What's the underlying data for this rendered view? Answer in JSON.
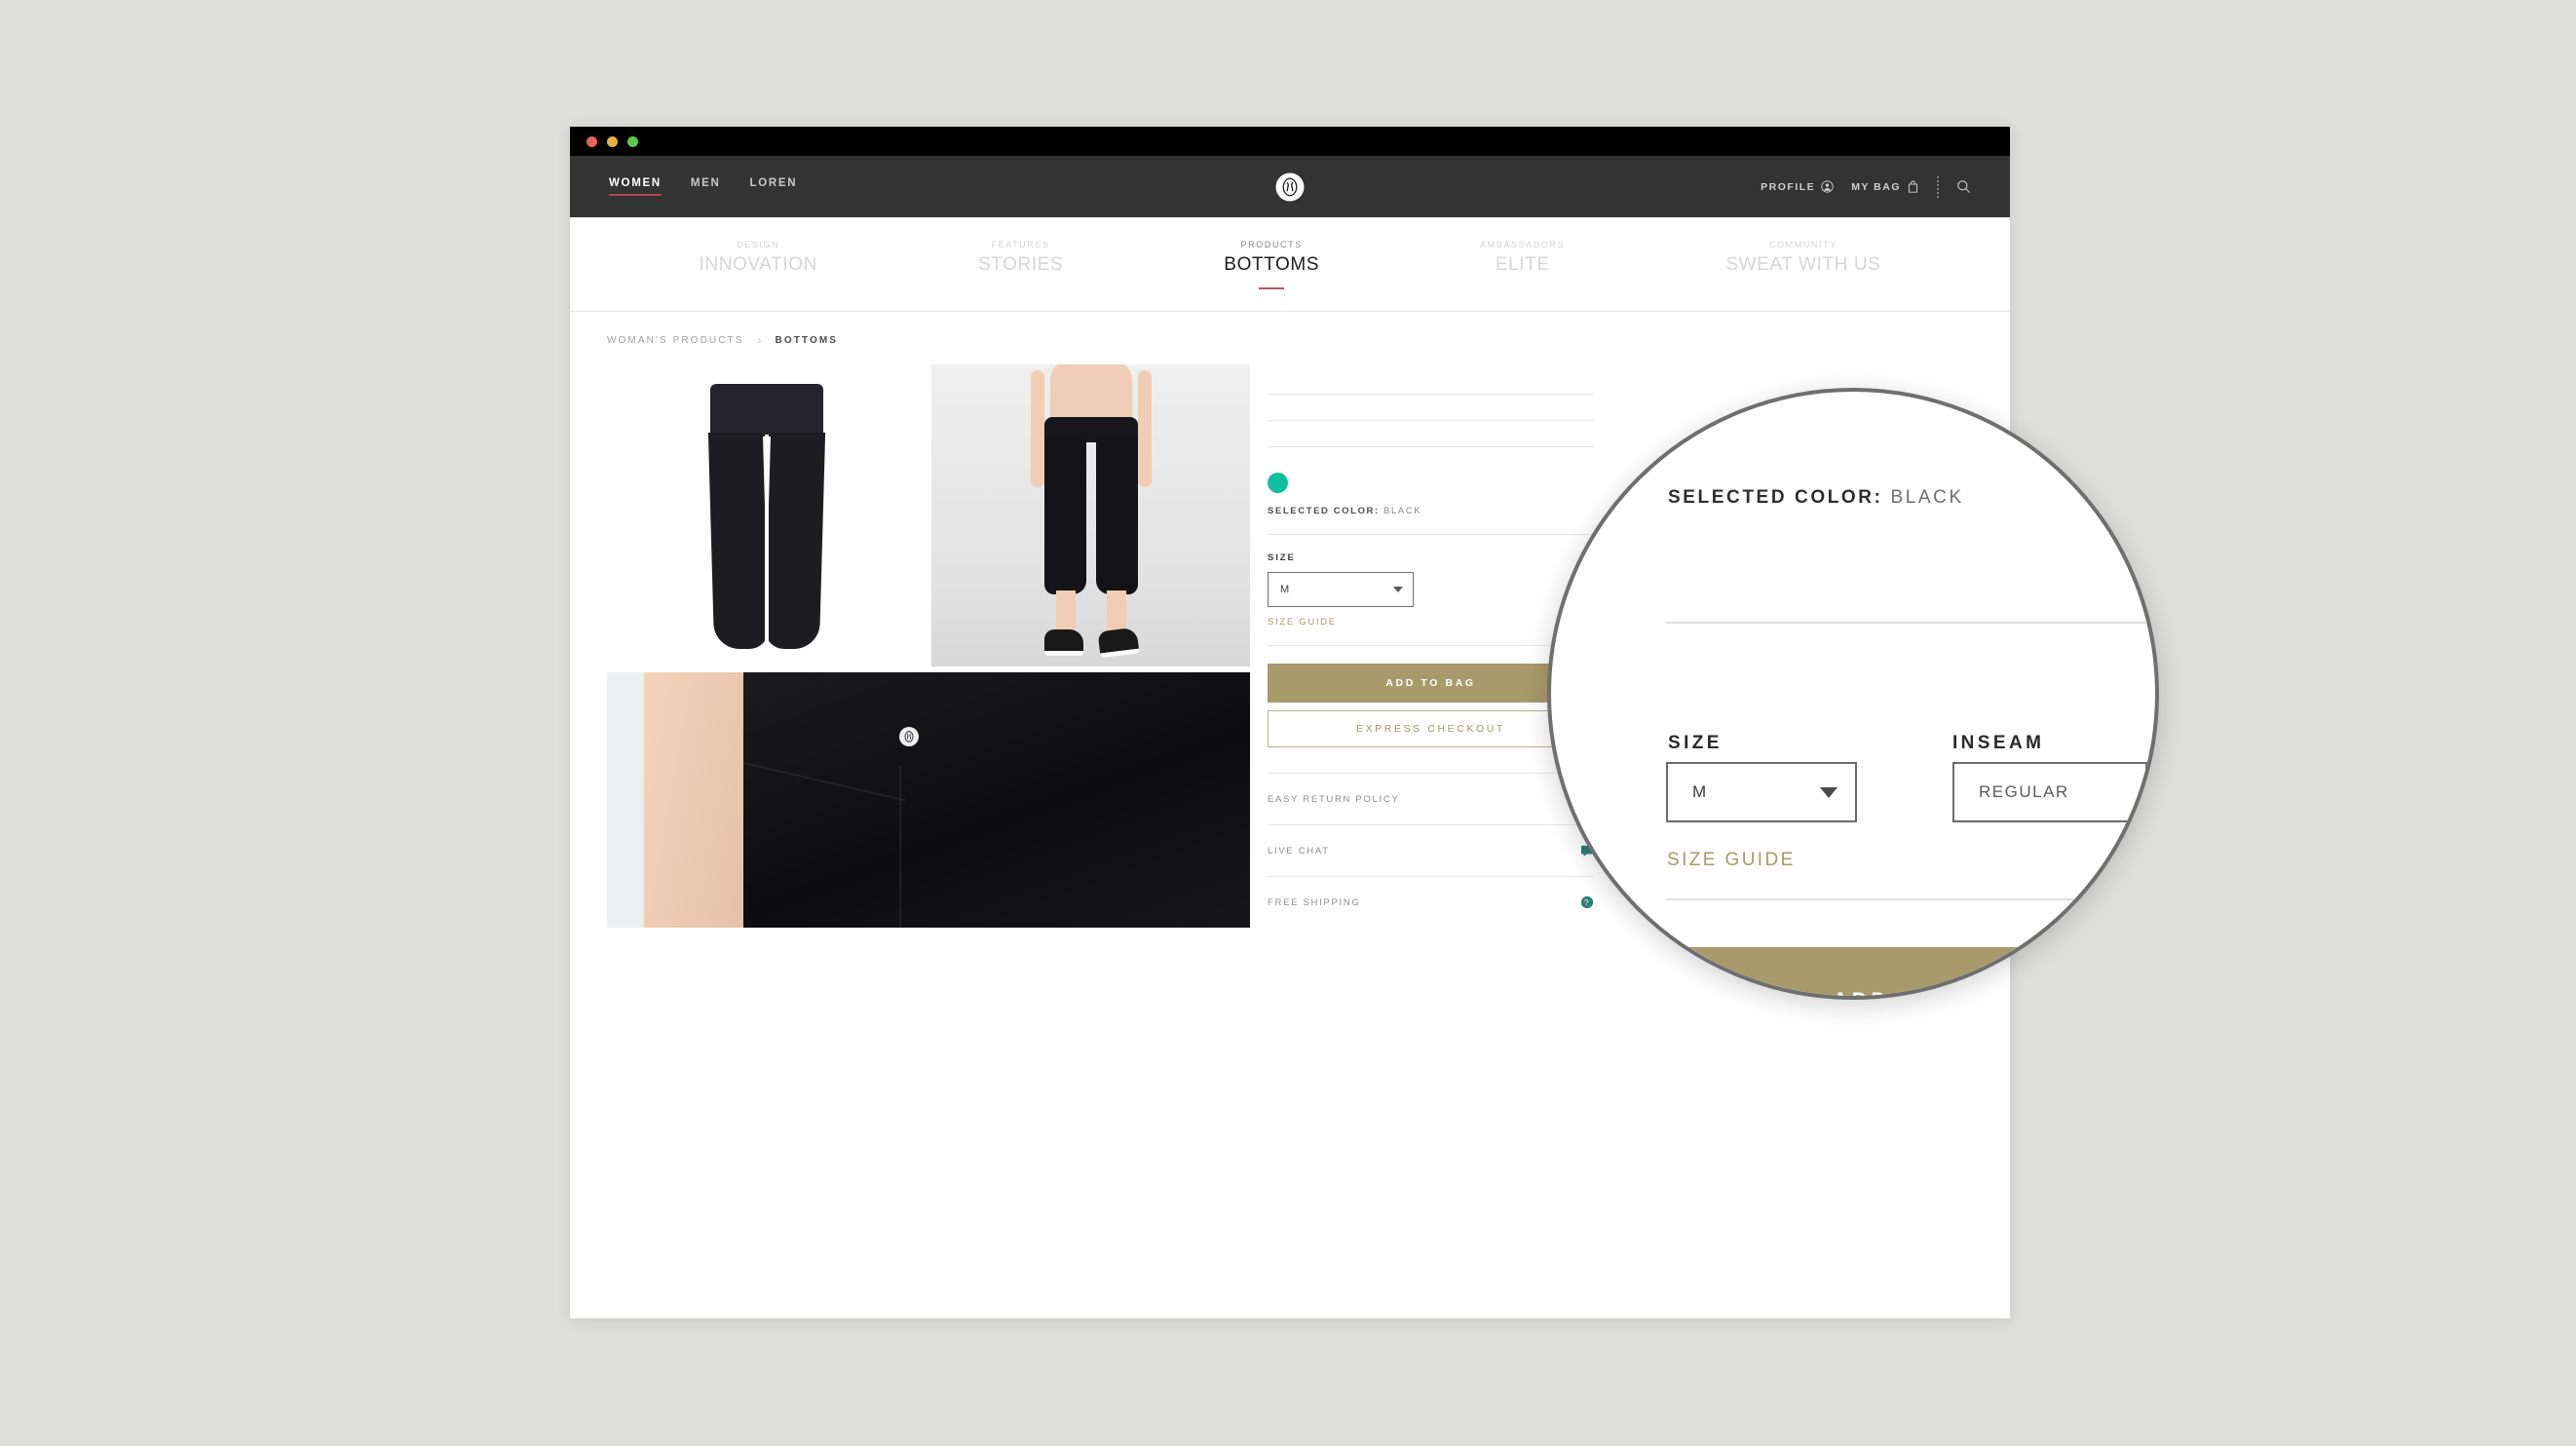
{
  "browser": {
    "traffic_lights": [
      "close",
      "minimize",
      "maximize"
    ]
  },
  "top_nav": {
    "left_items": [
      {
        "label": "WOMEN",
        "active": true
      },
      {
        "label": "MEN",
        "active": false
      },
      {
        "label": "LOREN",
        "active": false
      }
    ],
    "logo": "lululemon-omega-logo",
    "right_items": [
      {
        "label": "PROFILE",
        "icon": "person-icon"
      },
      {
        "label": "MY BAG",
        "icon": "shopping-bag-icon"
      }
    ],
    "search_icon": "search-icon"
  },
  "second_nav": {
    "items": [
      {
        "eyebrow": "DESIGN",
        "label": "INNOVATION",
        "active": false
      },
      {
        "eyebrow": "FEATURES",
        "label": "STORIES",
        "active": false
      },
      {
        "eyebrow": "PRODUCTS",
        "label": "BOTTOMS",
        "active": true
      },
      {
        "eyebrow": "AMBASSADORS",
        "label": "ELITE",
        "active": false
      },
      {
        "eyebrow": "COMMUNITY",
        "label": "SWEAT WITH US",
        "active": false
      }
    ]
  },
  "breadcrumb": {
    "items": [
      "WOMAN'S PRODUCTS",
      "BOTTOMS"
    ],
    "separator": "›"
  },
  "gallery": {
    "images": [
      {
        "name": "product-flatlay-black-crops"
      },
      {
        "name": "model-wearing-black-crops"
      },
      {
        "name": "waistband-detail-with-logo"
      }
    ]
  },
  "buy_panel": {
    "swatch_color": "#0fbfa0",
    "selected_color_label": "SELECTED COLOR:",
    "selected_color_value": "BLACK",
    "size_label": "SIZE",
    "size_value": "M",
    "inseam_label": "INSEAM",
    "inseam_value": "REGULAR",
    "size_guide": "SIZE GUIDE",
    "add_to_bag": "ADD TO BAG",
    "express_checkout": "EXPRESS CHECKOUT",
    "info_rows": [
      {
        "label": "EASY RETURN POLICY",
        "icon": "question-circle-icon"
      },
      {
        "label": "LIVE CHAT",
        "icon": "chat-bubble-icon"
      },
      {
        "label": "FREE SHIPPING",
        "icon": "question-circle-icon"
      }
    ]
  },
  "magnifier": {
    "selected_color_label": "SELECTED COLOR:",
    "selected_color_value": "BLACK",
    "size_label": "SIZE",
    "size_value": "M",
    "inseam_label": "INSEAM",
    "inseam_value": "REGULAR",
    "size_guide": "SIZE GUIDE",
    "add_to_bag": "ADD TO BAG"
  },
  "colors": {
    "gold": "#a89a6a",
    "teal": "#0fbfa0",
    "nav_dark": "#333333",
    "accent_red": "#a84a52",
    "page_bg": "#dededd"
  }
}
